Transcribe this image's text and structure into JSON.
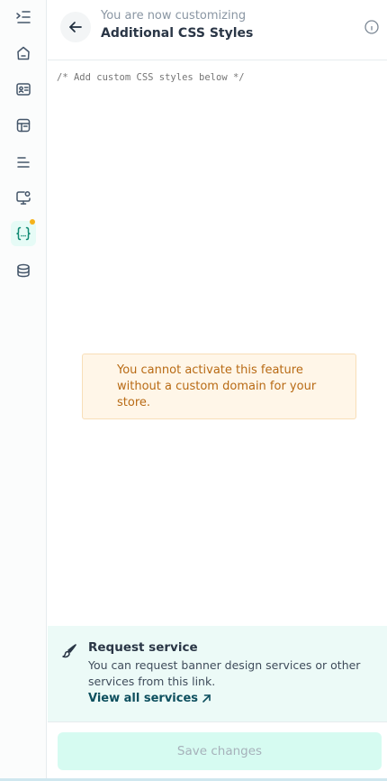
{
  "sidebar": {
    "items": [
      {
        "icon": "collapse-menu-icon",
        "active": false
      },
      {
        "icon": "home-icon",
        "active": false
      },
      {
        "icon": "id-card-icon",
        "active": false
      },
      {
        "icon": "layout-icon",
        "active": false
      },
      {
        "icon": "menu-lines-icon",
        "active": false
      },
      {
        "icon": "monitor-settings-icon",
        "active": false
      },
      {
        "icon": "code-braces-icon",
        "active": true,
        "badge_color": "#f5b21b"
      },
      {
        "icon": "database-box-icon",
        "active": false
      }
    ],
    "accent_color": "#0f8a72"
  },
  "header": {
    "subtitle": "You are now customizing",
    "title": "Additional CSS Styles",
    "back_icon": "arrow-left-icon",
    "info_icon": "info-icon"
  },
  "editor": {
    "placeholder": "/* Add custom CSS styles below */",
    "value": ""
  },
  "warning": {
    "text": "You cannot activate this feature without a custom domain for your store."
  },
  "request_service": {
    "icon": "brush-icon",
    "title": "Request service",
    "description": "You can request banner design services or other services from this link.",
    "link_label": "View all services",
    "link_icon": "arrow-up-right-icon"
  },
  "footer": {
    "save_label": "Save changes"
  }
}
